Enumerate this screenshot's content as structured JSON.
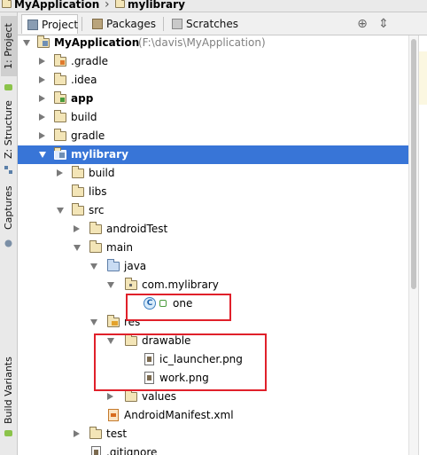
{
  "breadcrumb": {
    "items": [
      {
        "label": "MyApplication",
        "icon": "project-folder-icon"
      },
      {
        "label": "mylibrary",
        "icon": "module-folder-icon"
      }
    ],
    "separator": "›"
  },
  "left_strip": {
    "tabs": [
      "1: Project",
      "Z: Structure",
      "Captures",
      "Build Variants"
    ]
  },
  "tool_window": {
    "tabs": [
      {
        "label": "Project",
        "selected": true
      },
      {
        "label": "Packages",
        "selected": false
      },
      {
        "label": "Scratches",
        "selected": false
      }
    ],
    "tools": {
      "target": "⊕",
      "collapse": "⇕"
    }
  },
  "tree": [
    {
      "label": "MyApplication",
      "hint": "(F:\\davis\\MyApplication)",
      "bold": true
    },
    {
      "label": ".gradle"
    },
    {
      "label": ".idea"
    },
    {
      "label": "app",
      "bold": true
    },
    {
      "label": "build"
    },
    {
      "label": "gradle"
    },
    {
      "label": "mylibrary",
      "bold": true,
      "selected": true
    },
    {
      "label": "build"
    },
    {
      "label": "libs"
    },
    {
      "label": "src"
    },
    {
      "label": "androidTest"
    },
    {
      "label": "main"
    },
    {
      "label": "java"
    },
    {
      "label": "com.mylibrary"
    },
    {
      "label": "one",
      "class_letter": "C"
    },
    {
      "label": "res"
    },
    {
      "label": "drawable"
    },
    {
      "label": "ic_launcher.png"
    },
    {
      "label": "work.png"
    },
    {
      "label": "values"
    },
    {
      "label": "AndroidManifest.xml"
    },
    {
      "label": "test"
    },
    {
      "label": ".gitignore"
    }
  ],
  "colors": {
    "selection": "#3875d7",
    "annotation": "#e0202a"
  }
}
